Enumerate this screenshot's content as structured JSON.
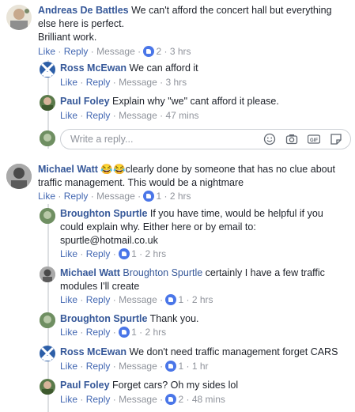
{
  "comments": [
    {
      "name": "Andreas De Battles",
      "text1": "We can't afford the concert hall but everything",
      "text2": "else here is perfect.",
      "text3": "Brilliant work.",
      "like": "Like",
      "reply": "Reply",
      "message": "Message",
      "count": "2",
      "time": "3 hrs"
    },
    {
      "name": "Ross McEwan",
      "text1": "We can afford it",
      "like": "Like",
      "reply": "Reply",
      "message": "Message",
      "time": "3 hrs"
    },
    {
      "name": "Paul Foley",
      "text1": "Explain why \"we\" cant afford it please.",
      "like": "Like",
      "reply": "Reply",
      "message": "Message",
      "time": "47 mins"
    },
    {
      "name": "Michael Watt",
      "emoji": "😂😂",
      "text1": "clearly done by someone that has no clue about",
      "text2": "traffic management. This would be a nightmare",
      "like": "Like",
      "reply": "Reply",
      "message": "Message",
      "count": "1",
      "time": "2 hrs"
    },
    {
      "name": "Broughton Spurtle",
      "text1": "If you have time, would be helpful if you",
      "text2": "could explain why. Either here or by email to:",
      "text3": "spurtle@hotmail.co.uk",
      "like": "Like",
      "reply": "Reply",
      "count": "1",
      "time": "2 hrs"
    },
    {
      "name": "Michael Watt",
      "mention": "Broughton Spurtle",
      "text1": "certainly I have a few traffic",
      "text2": "modules I'll create",
      "like": "Like",
      "reply": "Reply",
      "message": "Message",
      "count": "1",
      "time": "2 hrs"
    },
    {
      "name": "Broughton Spurtle",
      "text1": "Thank you.",
      "like": "Like",
      "reply": "Reply",
      "count": "1",
      "time": "2 hrs"
    },
    {
      "name": "Ross McEwan",
      "text1": "We don't need traffic management forget CARS",
      "like": "Like",
      "reply": "Reply",
      "message": "Message",
      "count": "1",
      "time": "1 hr"
    },
    {
      "name": "Paul Foley",
      "text1": "Forget cars? Oh my sides lol",
      "like": "Like",
      "reply": "Reply",
      "message": "Message",
      "count": "2",
      "time": "48 mins"
    }
  ],
  "reply_box": {
    "placeholder": "Write a reply..."
  },
  "icons": {
    "like": "thumbs-up-icon",
    "emoji": "smiley-icon",
    "camera": "camera-icon",
    "gif": "gif-icon",
    "sticker": "sticker-icon"
  },
  "colors": {
    "name": "#365899",
    "link": "#4267b2",
    "meta": "#90949c",
    "like_badge": "#4a76e8"
  }
}
